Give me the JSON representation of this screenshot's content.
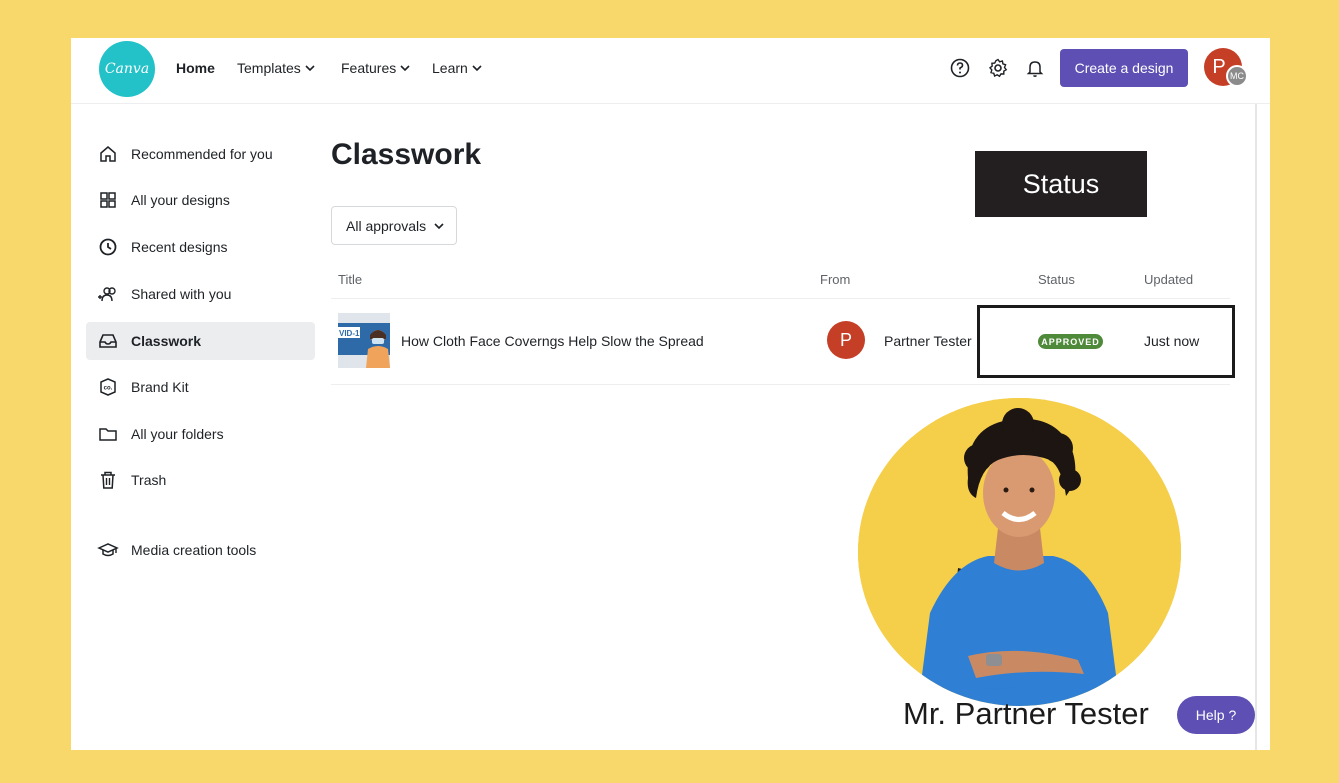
{
  "header": {
    "logo_text": "Canva",
    "nav": [
      {
        "label": "Home"
      },
      {
        "label": "Templates"
      },
      {
        "label": "Features"
      },
      {
        "label": "Learn"
      }
    ],
    "create_button": "Create a design",
    "avatar_initial": "P",
    "avatar_sub_initials": "MC"
  },
  "sidebar": {
    "items": [
      {
        "label": "Recommended for you",
        "icon": "home-icon"
      },
      {
        "label": "All your designs",
        "icon": "grid-icon"
      },
      {
        "label": "Recent designs",
        "icon": "clock-icon"
      },
      {
        "label": "Shared with you",
        "icon": "people-icon"
      },
      {
        "label": "Classwork",
        "icon": "inbox-icon",
        "active": true
      },
      {
        "label": "Brand Kit",
        "icon": "brand-kit-icon"
      },
      {
        "label": "All your folders",
        "icon": "folder-icon"
      },
      {
        "label": "Trash",
        "icon": "trash-icon"
      },
      {
        "label": "Media creation tools",
        "icon": "graduation-cap-icon"
      }
    ]
  },
  "main": {
    "title": "Classwork",
    "filter_label": "All approvals",
    "columns": {
      "title": "Title",
      "from": "From",
      "status": "Status",
      "updated": "Updated"
    },
    "rows": [
      {
        "thumb_text": "VID-19",
        "title": "How Cloth Face Coverngs Help Slow the Spread",
        "from_initial": "P",
        "from_name": "Partner Tester",
        "status": "APPROVED",
        "updated": "Just now"
      }
    ]
  },
  "overlay": {
    "status_callout": "Status",
    "caption": "Mr. Partner Tester"
  },
  "help_button": "Help ?",
  "colors": {
    "background": "#f8d86b",
    "brand_purple": "#5d4fb3",
    "logo_teal": "#22c2c8",
    "avatar_red": "#c43f26",
    "approved_green": "#4f8a3a"
  }
}
